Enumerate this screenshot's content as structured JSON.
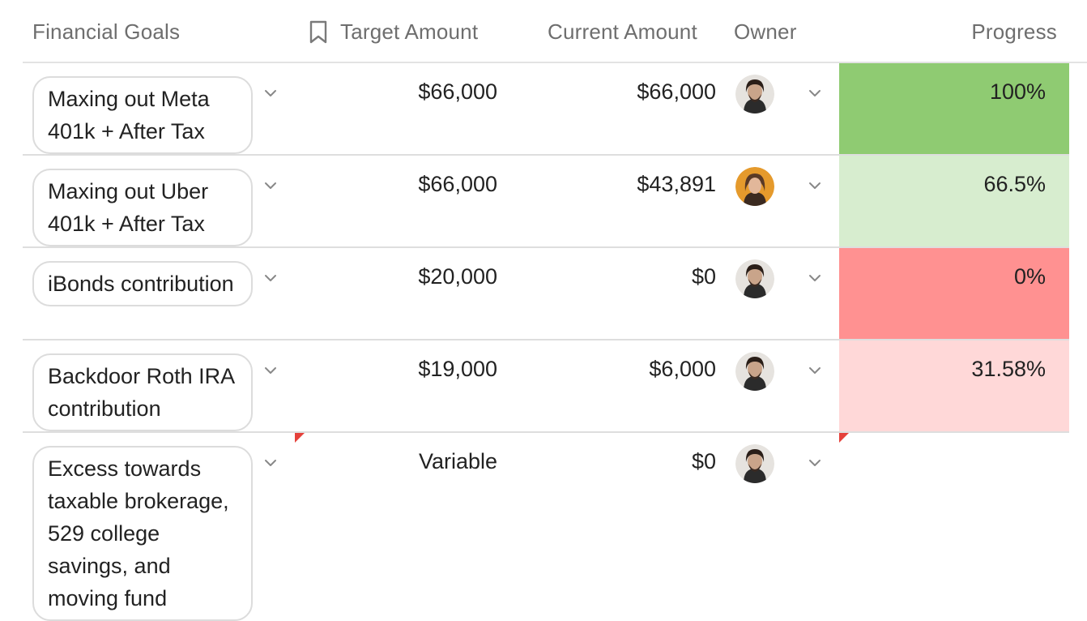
{
  "header": {
    "goal_label": "Financial Goals",
    "target_label": "Target Amount",
    "target_icon": "bookmark-icon",
    "current_label": "Current Amount",
    "owner_label": "Owner",
    "progress_label": "Progress"
  },
  "colors": {
    "progress_full": "#8fcb72",
    "progress_good": "#d7edcf",
    "progress_zero": "#ff9191",
    "progress_low": "#ffd8d8",
    "flag": "#e5413b"
  },
  "rows": [
    {
      "goal": "Maxing out Meta 401k + After Tax",
      "target": "$66,000",
      "current": "$66,000",
      "owner_avatar": "man-avatar",
      "progress": "100%",
      "progress_fraction": 1.0
    },
    {
      "goal": "Maxing out Uber 401k + After Tax",
      "target": "$66,000",
      "current": "$43,891",
      "owner_avatar": "woman-avatar",
      "progress": "66.5%",
      "progress_fraction": 0.665
    },
    {
      "goal": "iBonds contribution",
      "target": "$20,000",
      "current": "$0",
      "owner_avatar": "man-avatar",
      "progress": "0%",
      "progress_fraction": 0
    },
    {
      "goal": "Backdoor Roth IRA contribution",
      "target": "$19,000",
      "current": "$6,000",
      "owner_avatar": "man-avatar",
      "progress": "31.58%",
      "progress_fraction": 0.3158
    },
    {
      "goal": "Excess towards taxable brokerage, 529 college savings, and moving fund",
      "target": "Variable",
      "current": "$0",
      "owner_avatar": "man-avatar",
      "progress": "",
      "progress_fraction": null
    }
  ]
}
